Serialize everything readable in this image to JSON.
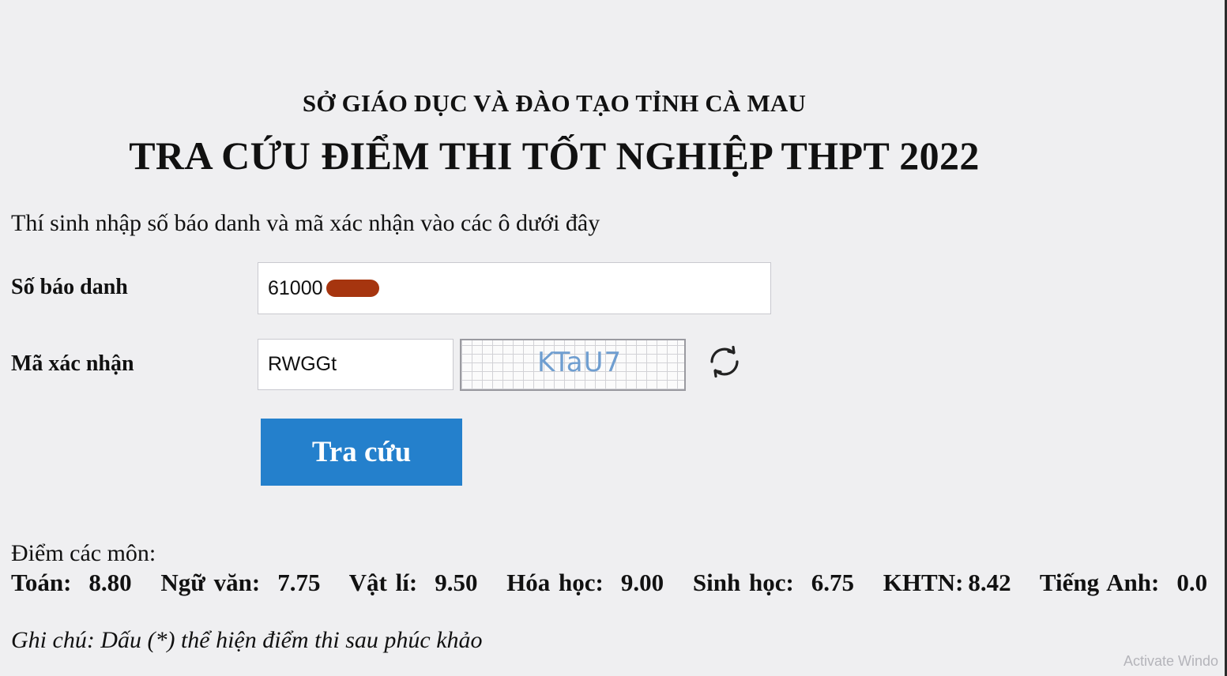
{
  "header": {
    "org": "SỞ GIÁO DỤC VÀ ĐÀO TẠO TỈNH CÀ MAU",
    "title": "TRA CỨU ĐIỂM THI TỐT NGHIỆP THPT 2022"
  },
  "form": {
    "instruction": "Thí sinh nhập số báo danh và mã xác nhận vào các ô dưới đây",
    "candidate_id_label": "Số báo danh",
    "candidate_id_value": "61000",
    "captcha_label": "Mã xác nhận",
    "captcha_value": "RWGGt",
    "captcha_image_text": "KTaU7",
    "submit_label": "Tra cứu"
  },
  "results": {
    "heading": "Điểm các môn:",
    "scores": [
      {
        "subject": "Toán:",
        "score": "8.80"
      },
      {
        "subject": "Ngữ văn:",
        "score": "7.75"
      },
      {
        "subject": "Vật lí:",
        "score": "9.50"
      },
      {
        "subject": "Hóa học:",
        "score": "9.00"
      },
      {
        "subject": "Sinh học:",
        "score": "6.75"
      },
      {
        "subject": "KHTN:",
        "score": "8.42"
      },
      {
        "subject": "Tiếng Anh:",
        "score": "0.0"
      }
    ],
    "note": "Ghi chú: Dấu (*) thể hiện điểm thi sau phúc khảo"
  },
  "overlay": {
    "watermark": "Activate Windo"
  },
  "icons": {
    "refresh": "refresh-icon"
  },
  "colors": {
    "background": "#efeff1",
    "button": "#2480cc",
    "captcha_text": "#6f9ed0",
    "redaction": "#a6350f"
  }
}
